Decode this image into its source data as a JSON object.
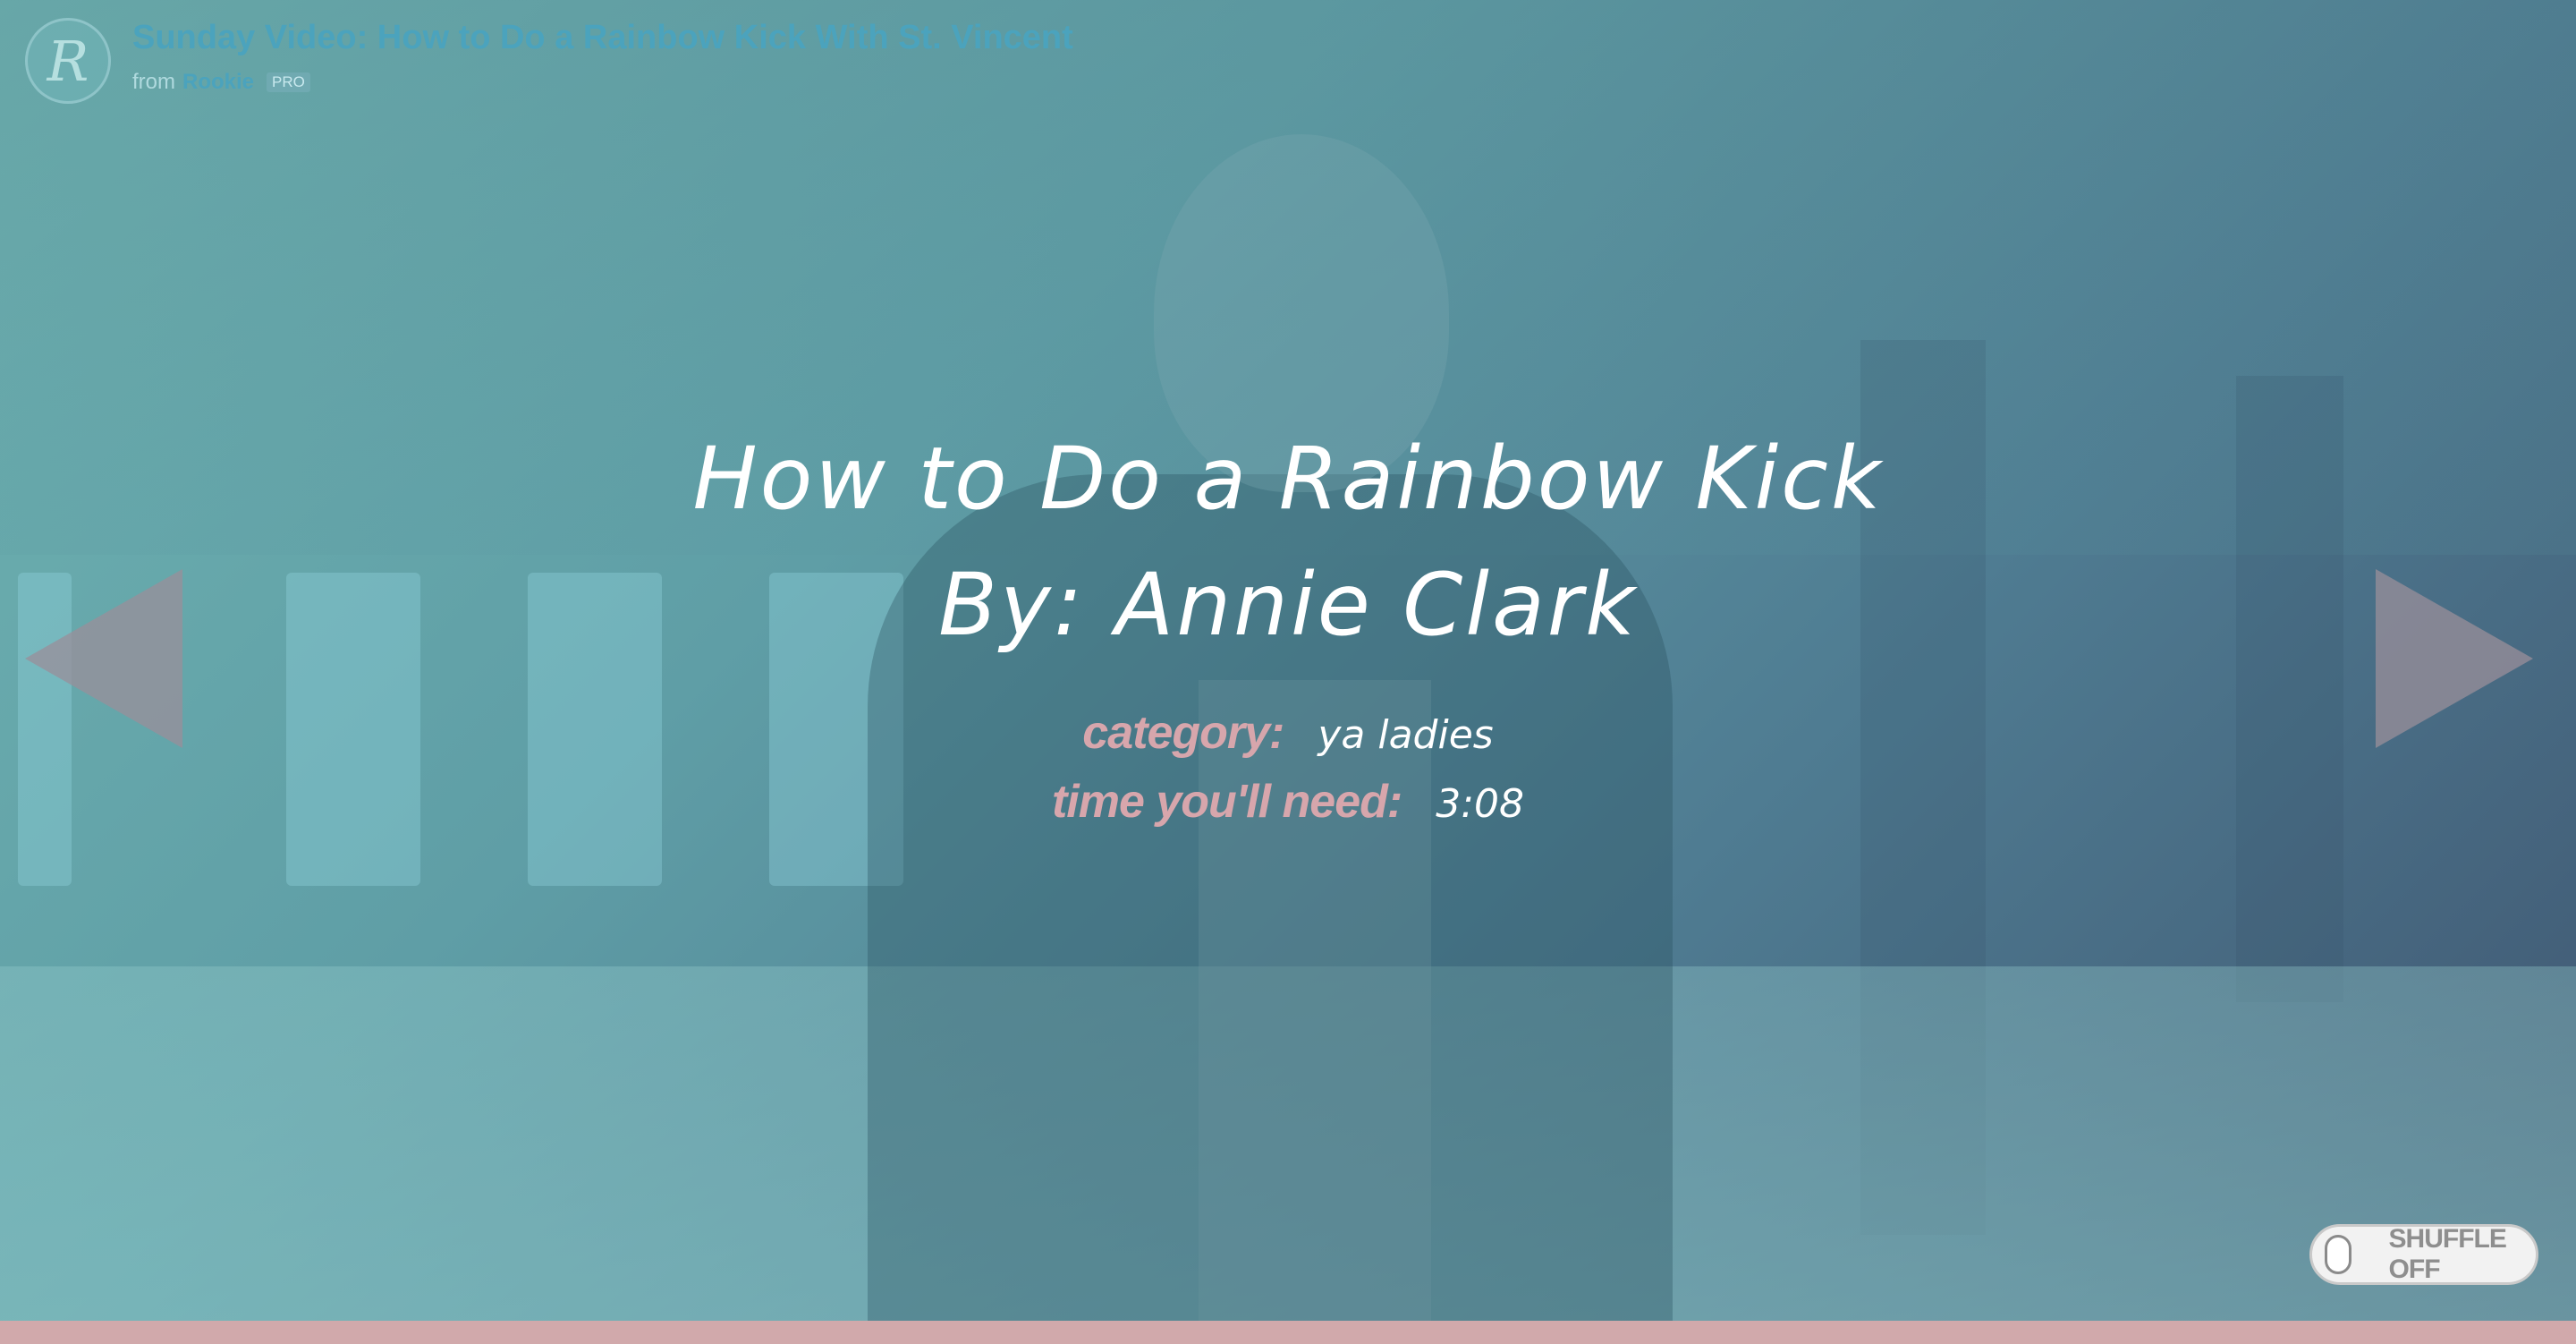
{
  "video": {
    "channel_avatar_letter": "R",
    "title": "Sunday Video: How to Do a Rainbow Kick With St. Vincent",
    "from_label": "from",
    "channel_name": "Rookie",
    "badge": "PRO"
  },
  "content": {
    "title": "How to Do a Rainbow Kick",
    "author": "By: Annie Clark",
    "category_label": "category:",
    "category_value": "ya ladies",
    "time_label": "time you'll need:",
    "time_value": "3:08"
  },
  "navigation": {
    "prev_icon": "triangle-left-icon",
    "next_icon": "triangle-right-icon"
  },
  "shuffle": {
    "label": "SHUFFLE OFF",
    "state": "off"
  },
  "colors": {
    "accent_pink": "#d7a6ac",
    "title_blue": "#4ba3bd",
    "bottom_bar": "#d1a9ab",
    "arrow": "#9a8f9a"
  }
}
